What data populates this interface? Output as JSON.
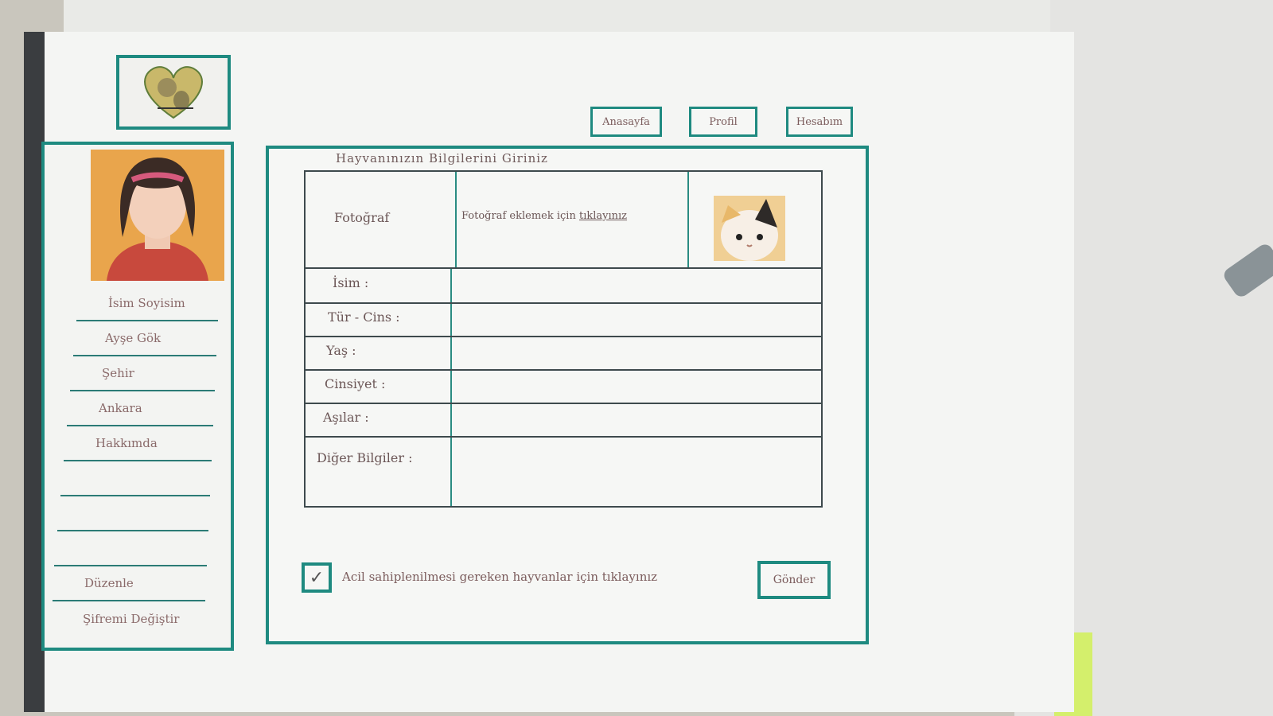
{
  "nav": {
    "home_label": "Anasayfa",
    "profile_label": "Profil",
    "account_label": "Hesabım"
  },
  "sidebar": {
    "items": [
      {
        "label": "İsim Soyisim"
      },
      {
        "label": "Ayşe Gök"
      },
      {
        "label": "Şehir"
      },
      {
        "label": "Ankara"
      },
      {
        "label": "Hakkımda"
      },
      {
        "label": ""
      },
      {
        "label": ""
      },
      {
        "label": ""
      },
      {
        "label": "Düzenle"
      },
      {
        "label": "Şifremi Değiştir"
      }
    ]
  },
  "form": {
    "title": "Hayvanınızın Bilgilerini Giriniz",
    "photo_label": "Fotoğraf",
    "photo_hint_prefix": "Fotoğraf eklemek için",
    "photo_hint_link": "tıklayınız",
    "name_label": "İsim :",
    "breed_label": "Tür - Cins :",
    "age_label": "Yaş :",
    "gender_label": "Cinsiyet :",
    "vaccines_label": "Aşılar :",
    "other_label": "Diğer Bilgiler :"
  },
  "adopt_checkbox": {
    "checked": true,
    "label": "Acil sahiplenilmesi gereken hayvanlar için tıklayınız"
  },
  "submit_label": "Gönder",
  "colors": {
    "accent": "#1e8a80",
    "paper": "#f4f5f3"
  }
}
